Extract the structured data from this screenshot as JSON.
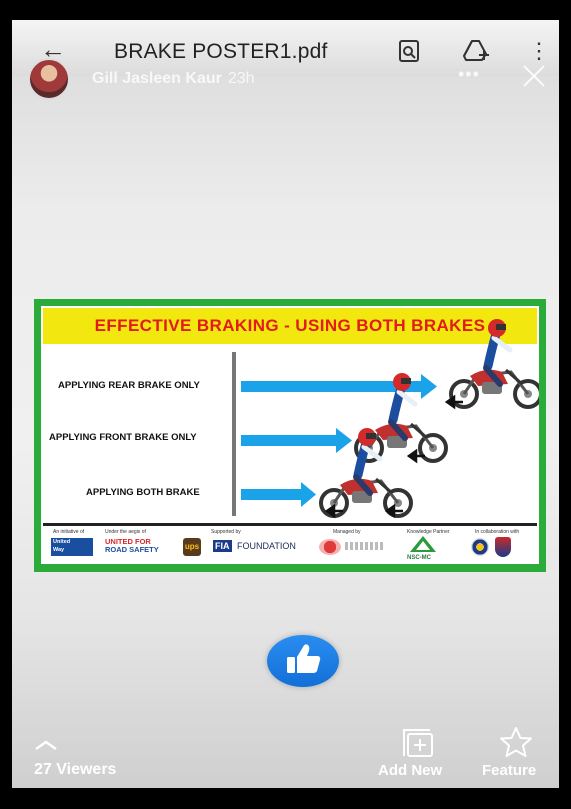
{
  "pdf_viewer": {
    "title": "BRAKE POSTER1.pdf",
    "icons": [
      "back-arrow-icon",
      "search-document-icon",
      "add-to-drive-icon",
      "more-vertical-icon"
    ]
  },
  "story": {
    "user_name": "Gill Jasleen Kaur",
    "time_ago": "23h",
    "more": "•••"
  },
  "poster": {
    "title": "EFFECTIVE BRAKING - USING BOTH BRAKES",
    "rows": [
      {
        "label": "APPLYING REAR BRAKE ONLY"
      },
      {
        "label": "APPLYING FRONT BRAKE ONLY"
      },
      {
        "label": "APPLYING BOTH BRAKE"
      }
    ],
    "footer_labels": [
      "An initiative of",
      "Under the aegis of",
      "Supported by",
      "Managed by",
      "Knowledge Partner",
      "In collaboration with"
    ],
    "logos": {
      "united_way_1": "United",
      "united_way_2": "Way",
      "united_for_1": "UNITED FOR",
      "united_for_2": "ROAD SAFETY",
      "ups": "ups",
      "fia": "FIA",
      "foundation": "FOUNDATION",
      "nsc": "NSC-MC"
    },
    "colors": {
      "border": "#2bab3a",
      "title_bg": "#f2e70e",
      "title_text": "#e21b1b",
      "arrow": "#1aa3e8"
    }
  },
  "bottom": {
    "viewers": "27 Viewers",
    "add_new": "Add New",
    "feature": "Feature",
    "like_color": "#1877f2"
  }
}
